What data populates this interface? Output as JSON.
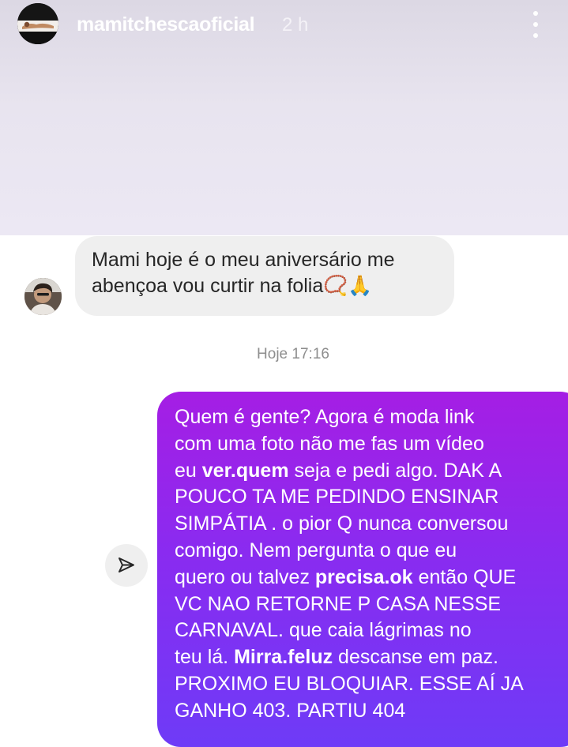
{
  "story": {
    "username": "mamitchescaoficial",
    "time_ago": "2 h",
    "more_icon": "more-vertical-icon"
  },
  "incoming_message": {
    "line1": "Mami hoje é o meu aniversário me",
    "line2": "abençoa vou curtir na folia📿🙏"
  },
  "timestamp": "Hoje 17:16",
  "share_icon": "send-icon",
  "outgoing_message": {
    "lines": [
      [
        "Quem é gente? Agora é moda link"
      ],
      [
        "com uma foto não me fas um vídeo"
      ],
      [
        "eu ",
        "ver.quem",
        " seja e pedi algo. DAK A"
      ],
      [
        "POUCO TA ME PEDINDO ENSINAR"
      ],
      [
        "SIMPÁTIA . o pior Q nunca conversou"
      ],
      [
        "comigo. Nem pergunta o que eu"
      ],
      [
        "quero ou talvez ",
        "precisa.ok",
        " então QUE"
      ],
      [
        "VC NAO RETORNE P CASA NESSE"
      ],
      [
        "CARNAVAL. que caia lágrimas no"
      ],
      [
        "teu lá. ",
        "Mirra.feluz",
        " descanse em paz."
      ],
      [
        "PROXIMO EU BLOQUIAR. ESSE AÍ JA"
      ],
      [
        "GANHO 403. PARTIU 404"
      ]
    ]
  },
  "colors": {
    "bubble_gradient_top": "#a51ee4",
    "bubble_gradient_bottom": "#6e3bf7",
    "incoming_bubble": "#efefef"
  }
}
